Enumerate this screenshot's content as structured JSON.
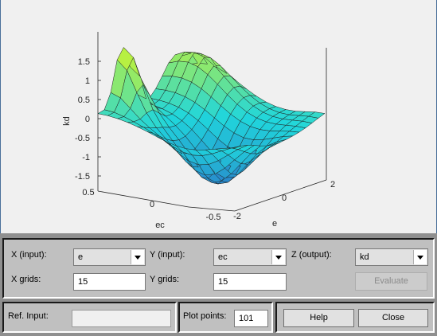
{
  "plot": {
    "title": "",
    "z_axis_label": "kd",
    "x_axis_label": "e",
    "y_axis_label": "ec",
    "z_ticks": [
      "1.5",
      "1",
      "0.5",
      "0",
      "-0.5",
      "-1",
      "-1.5"
    ],
    "x_ticks": [
      "-2",
      "0",
      "2"
    ],
    "y_ticks": [
      "0.5",
      "0",
      "-0.5"
    ],
    "colors": {
      "low": "#2a7cc9",
      "mid": "#20d6dc",
      "high": "#b7f042",
      "axis": "#262626"
    }
  },
  "chart_data": {
    "type": "surface",
    "x_label": "e",
    "y_label": "ec",
    "z_label": "kd",
    "x_range": [
      -2,
      2
    ],
    "y_range": [
      -0.5,
      0.5
    ],
    "z_range": [
      -1.5,
      1.5
    ],
    "grid": "off"
  },
  "controls": {
    "x_input_label": "X (input):",
    "x_input_value": "e",
    "y_input_label": "Y (input):",
    "y_input_value": "ec",
    "z_output_label": "Z (output):",
    "z_output_value": "kd",
    "x_grids_label": "X grids:",
    "x_grids_value": "15",
    "y_grids_label": "Y grids:",
    "y_grids_value": "15",
    "evaluate_label": "Evaluate",
    "ref_input_label": "Ref. Input:",
    "ref_input_value": "",
    "plot_points_label": "Plot points:",
    "plot_points_value": "101",
    "help_label": "Help",
    "close_label": "Close"
  }
}
